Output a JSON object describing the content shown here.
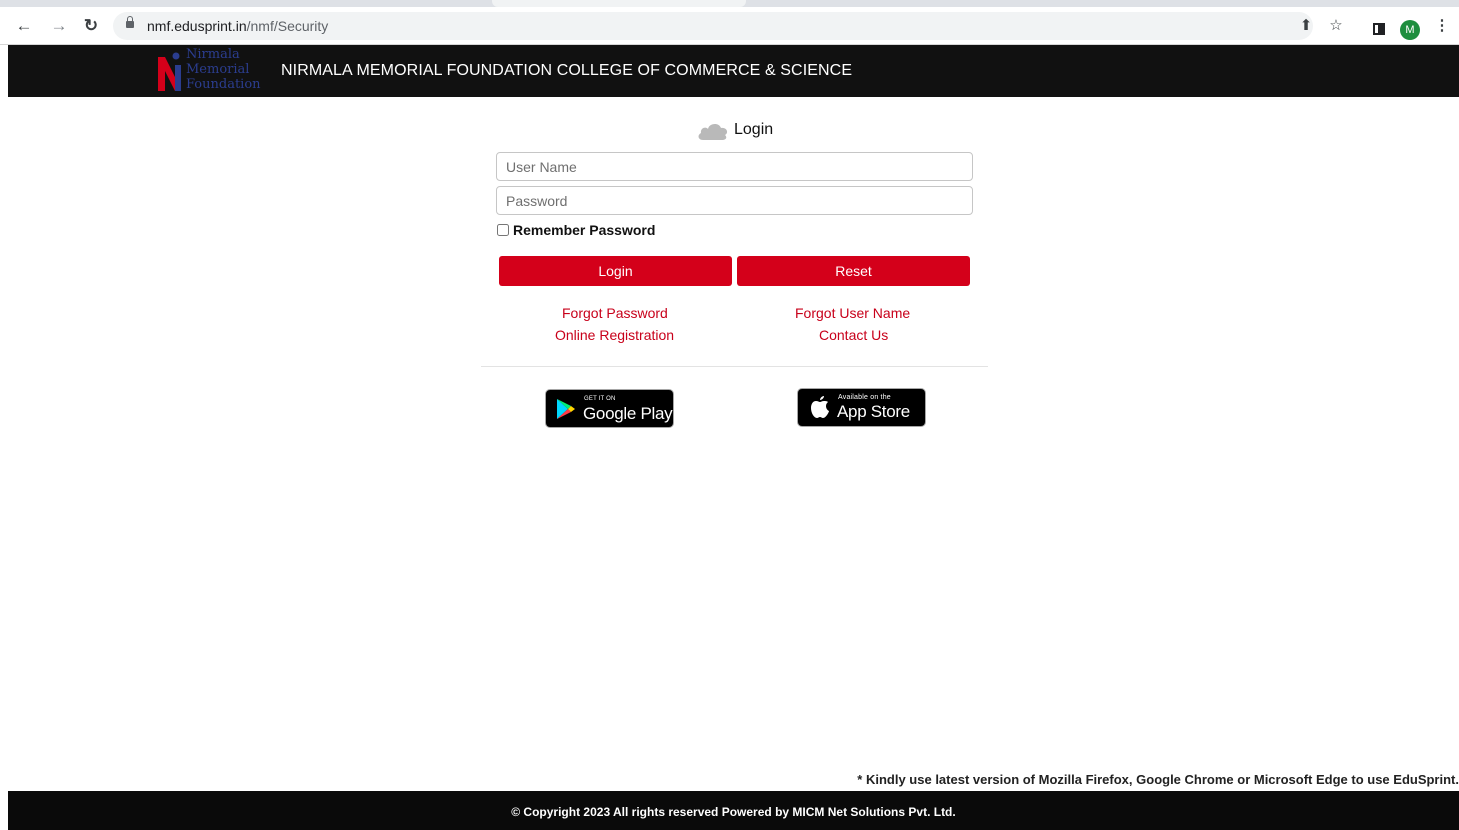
{
  "browser": {
    "url_host": "nmf.edusprint.in",
    "url_path": "/nmf/Security",
    "profile_initial": "M",
    "icons": [
      "back-icon",
      "forward-icon",
      "reload-icon",
      "lock-icon",
      "share-icon",
      "star-icon",
      "sidebar-icon",
      "avatar",
      "menu-icon"
    ]
  },
  "header": {
    "logo_lines": [
      "Nirmala",
      "Memorial",
      "Foundation"
    ],
    "title": "NIRMALA MEMORIAL FOUNDATION COLLEGE OF COMMERCE & SCIENCE"
  },
  "login": {
    "heading": "Login",
    "username_placeholder": "User Name",
    "password_placeholder": "Password",
    "remember_label": "Remember Password",
    "login_button": "Login",
    "reset_button": "Reset",
    "links": {
      "forgot_password": "Forgot Password",
      "forgot_username": "Forgot User Name",
      "online_registration": "Online Registration",
      "contact_us": "Contact Us"
    }
  },
  "stores": {
    "google_small": "GET IT ON",
    "google_big": "Google Play",
    "apple_small": "Available on the",
    "apple_big": "App Store"
  },
  "notice": "* Kindly use latest version of Mozilla Firefox, Google Chrome or Microsoft Edge to use EduSprint.",
  "footer": "© Copyright 2023 All rights reserved Powered by MICM Net Solutions Pvt. Ltd.",
  "colors": {
    "accent": "#d4001a",
    "link": "#c8001a",
    "header_bg": "#111111",
    "footer_bg": "#0a0a0a"
  }
}
